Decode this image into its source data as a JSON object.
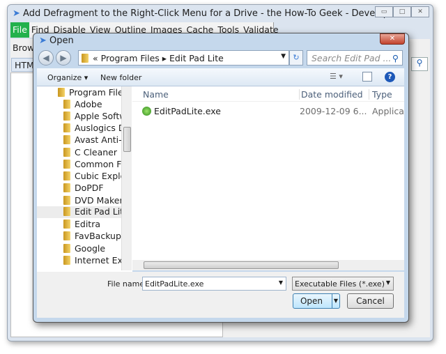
{
  "window": {
    "title": "Add Defragment to the Right-Click Menu for a Drive - the How-To Geek - Developer Tools",
    "minimize": "▭",
    "maximize": "□",
    "close": "✕"
  },
  "menu": [
    "File",
    "Find",
    "Disable",
    "View",
    "Outline",
    "Images",
    "Cache",
    "Tools",
    "Validate"
  ],
  "background": {
    "toolbar_label": "Brow",
    "tab_label": "HTM"
  },
  "dialog": {
    "title": "Open",
    "close": "✕",
    "address": {
      "prefix": "«",
      "crumbs": [
        "Program Files",
        "Edit Pad Lite"
      ]
    },
    "search_placeholder": "Search Edit Pad ...",
    "commands": {
      "organize": "Organize ▾",
      "new_folder": "New folder"
    },
    "nav_items": [
      "Program Files",
      "Adobe",
      "Apple Softw",
      "Auslogics D",
      "Avast Anti-V",
      "C Cleaner",
      "Common Fil",
      "Cubic Explor",
      "DoPDF",
      "DVD Maker",
      "Edit Pad Lit",
      "Editra",
      "FavBackup",
      "Google",
      "Internet Exp"
    ],
    "selected_nav": "Edit Pad Lit",
    "columns": [
      "Name",
      "Date modified",
      "Type"
    ],
    "files": [
      {
        "name": "EditPadLite.exe",
        "date": "2009-12-09 6...",
        "type": "Applicat"
      }
    ],
    "file_name_label": "File name:",
    "file_name_value": "EditPadLite.exe",
    "file_type": "Executable Files (*.exe)",
    "open": "Open",
    "cancel": "Cancel"
  }
}
